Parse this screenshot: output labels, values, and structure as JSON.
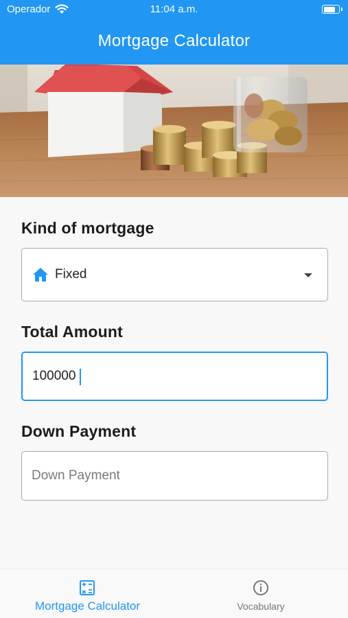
{
  "status_bar": {
    "carrier": "Operador",
    "time": "11:04 a.m.",
    "battery_level": 0.8
  },
  "app_bar": {
    "title": "Mortgage Calculator"
  },
  "banner": {
    "image_subject": "model house with stacks of coins"
  },
  "form": {
    "mortgage_kind": {
      "label": "Kind of mortgage",
      "selected_value": "Fixed",
      "icon": "home-icon"
    },
    "total_amount": {
      "label": "Total Amount",
      "value": "100000",
      "placeholder": ""
    },
    "down_payment": {
      "label": "Down Payment",
      "value": "",
      "placeholder": "Down Payment"
    }
  },
  "bottom_nav": {
    "items": [
      {
        "label": "Mortgage Calculator",
        "icon": "calculator-icon",
        "active": true
      },
      {
        "label": "Vocabulary",
        "icon": "info-icon",
        "active": false
      }
    ]
  },
  "colors": {
    "primary": "#2196f3",
    "inactive": "#757575"
  }
}
